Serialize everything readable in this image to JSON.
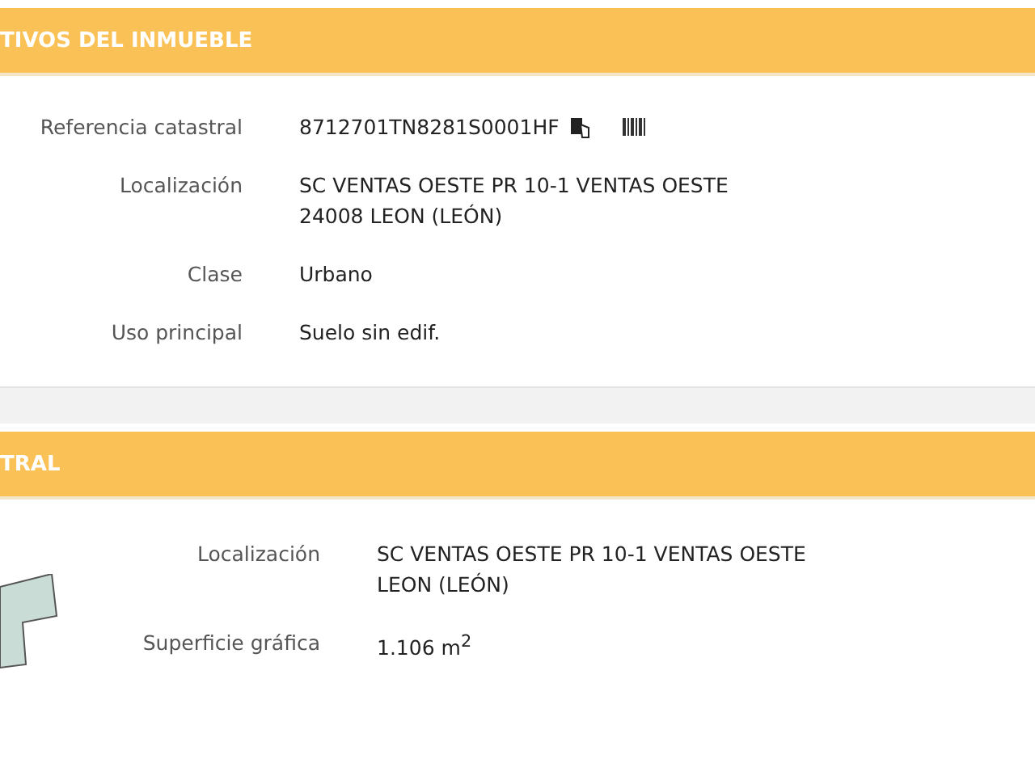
{
  "panels": [
    {
      "title": "TIVOS DEL INMUEBLE",
      "has_parcel": false,
      "rows": [
        {
          "label": "Referencia catastral",
          "lines": [
            "8712701TN8281S0001HF"
          ],
          "icons": true
        },
        {
          "label": "Localización",
          "lines": [
            "SC VENTAS OESTE PR 10-1 VENTAS OESTE",
            "24008 LEON (LEÓN)"
          ],
          "icons": false
        },
        {
          "label": "Clase",
          "lines": [
            "Urbano"
          ],
          "icons": false
        },
        {
          "label": "Uso principal",
          "lines": [
            "Suelo sin edif."
          ],
          "icons": false
        }
      ]
    },
    {
      "title": "TRAL",
      "has_parcel": true,
      "rows": [
        {
          "label": "Localización",
          "lines": [
            "SC VENTAS OESTE PR 10-1 VENTAS OESTE",
            "LEON (LEÓN)"
          ],
          "icons": false
        },
        {
          "label": "Superficie gráfica",
          "lines": [
            "1.106 m$^{2}$"
          ],
          "icons": false
        }
      ]
    }
  ]
}
